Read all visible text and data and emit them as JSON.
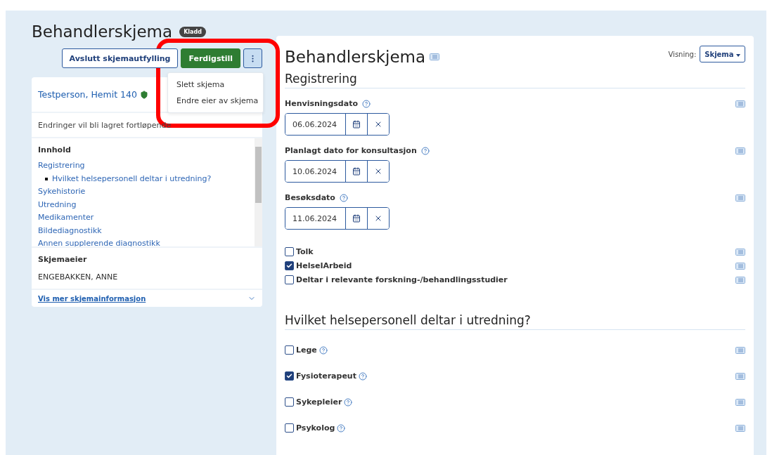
{
  "header": {
    "title": "Behandlerskjema",
    "badge": "Kladd"
  },
  "actions": {
    "buttons": [
      {
        "label": "Avslutt skjemautfylling",
        "kind": "outline"
      },
      {
        "label": "Ferdigstill",
        "kind": "primary"
      }
    ],
    "menu": {
      "expanded": true,
      "items": [
        "Slett skjema",
        "Endre eier av skjema"
      ]
    }
  },
  "patient": {
    "name": "Testperson, Hemit 140"
  },
  "autosave_note": "Endringer vil bli lagret fortløpende",
  "toc": {
    "title": "Innhold",
    "items": [
      {
        "label": "Registrering",
        "children": [
          {
            "label": "Hvilket helsepersonell deltar i utredning?"
          }
        ]
      },
      {
        "label": "Sykehistorie"
      },
      {
        "label": "Utredning"
      },
      {
        "label": "Medikamenter"
      },
      {
        "label": "Bildediagnostikk"
      },
      {
        "label": "Annen supplerende diagnostikk"
      }
    ]
  },
  "owner": {
    "title": "Skjemaeier",
    "name": "ENGEBAKKEN, ANNE"
  },
  "more_link": "Vis mer skjemainformasjon",
  "form": {
    "title": "Behandlerskjema",
    "view_label": "Visning:",
    "view_value": "Skjema",
    "sections": [
      {
        "title": "Registrering",
        "fields": [
          {
            "kind": "date",
            "label": "Henvisningsdato",
            "help": true,
            "value": "06.06.2024"
          },
          {
            "kind": "date",
            "label": "Planlagt dato for konsultasjon",
            "help": true,
            "value": "10.06.2024"
          },
          {
            "kind": "date",
            "label": "Besøksdato",
            "help": true,
            "value": "11.06.2024"
          },
          {
            "kind": "checkbox",
            "label": "Tolk",
            "help": false,
            "checked": false
          },
          {
            "kind": "checkbox",
            "label": "HelseIArbeid",
            "help": false,
            "checked": true
          },
          {
            "kind": "checkbox",
            "label": "Deltar i relevante forskning-/behandlingsstudier",
            "help": false,
            "checked": false
          }
        ]
      },
      {
        "title": "Hvilket helsepersonell deltar i utredning?",
        "fields": [
          {
            "kind": "checkbox",
            "label": "Lege",
            "help": true,
            "checked": false
          },
          {
            "kind": "checkbox",
            "label": "Fysioterapeut",
            "help": true,
            "checked": true
          },
          {
            "kind": "checkbox",
            "label": "Sykepleier",
            "help": true,
            "checked": false
          },
          {
            "kind": "checkbox",
            "label": "Psykolog",
            "help": true,
            "checked": false
          }
        ]
      }
    ]
  }
}
